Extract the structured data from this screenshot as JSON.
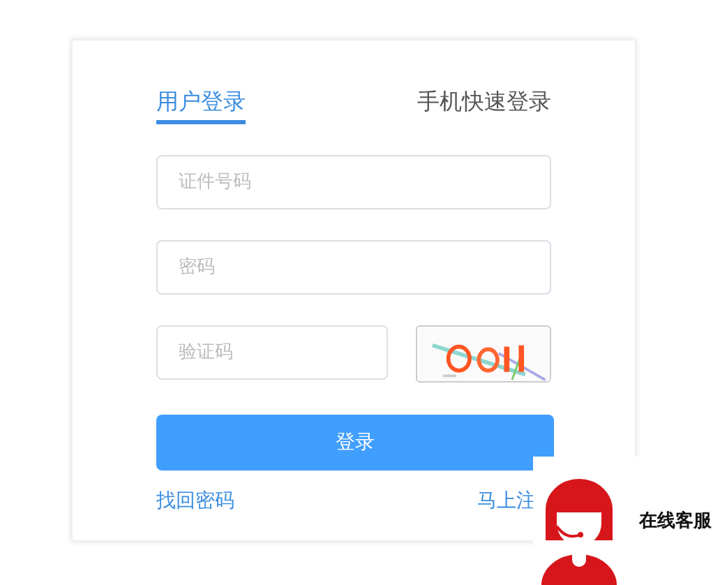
{
  "tabs": [
    {
      "label": "用户登录",
      "selected": true
    },
    {
      "label": "手机快速登录",
      "selected": false
    }
  ],
  "fields": [
    {
      "kind": "text",
      "placeholder": "证件号码"
    },
    {
      "kind": "password",
      "placeholder": "密码"
    },
    {
      "kind": "captcha",
      "placeholder": "验证码"
    }
  ],
  "login_button": "登录",
  "links": {
    "forgot": "找回密码",
    "register": "马上注"
  },
  "support_widget": {
    "label": "在线客服"
  }
}
